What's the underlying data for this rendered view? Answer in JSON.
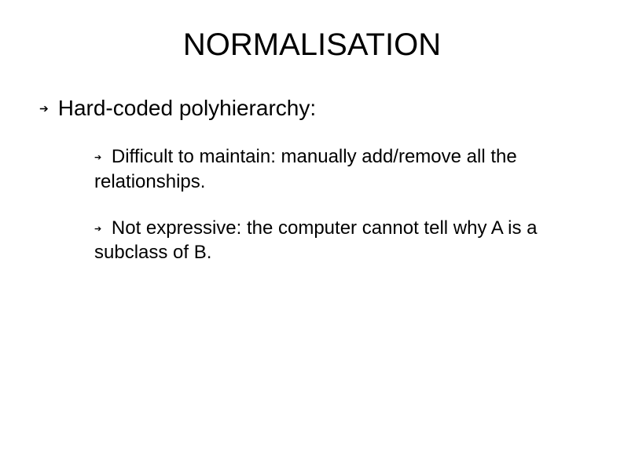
{
  "slide": {
    "title": "NORMALISATION",
    "main_bullet": {
      "text": "Hard-coded polyhierarchy:"
    },
    "sub_bullets": [
      {
        "text": "Difficult to maintain: manually add/remove all the relationships."
      },
      {
        "text": "Not expressive: the computer cannot tell why A is a subclass of B."
      }
    ]
  }
}
